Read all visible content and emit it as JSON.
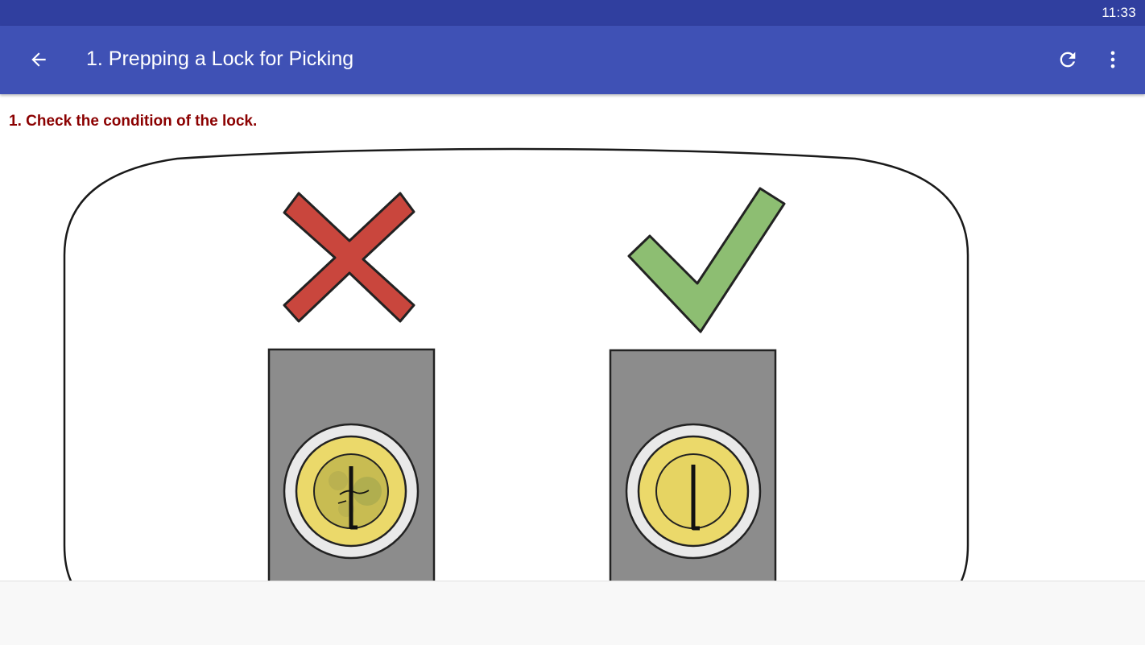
{
  "status_bar": {
    "time": "11:33"
  },
  "app_bar": {
    "title": "1. Prepping a Lock for Picking",
    "back_icon": "arrow-back-icon",
    "refresh_icon": "refresh-icon",
    "menu_icon": "more-vert-icon",
    "color": "#3F51B5",
    "status_color": "#303F9F"
  },
  "content": {
    "step_text": "1. Check the condition of the lock.",
    "step_text_color": "#8B0000",
    "illustration": {
      "bad_marker_icon": "x-mark-icon",
      "good_marker_icon": "check-mark-icon",
      "bad_color": "#C9463D",
      "good_color": "#8DBE72",
      "lock_body_color": "#8C8C8C",
      "keyhole_color": "#EBD96A"
    }
  }
}
